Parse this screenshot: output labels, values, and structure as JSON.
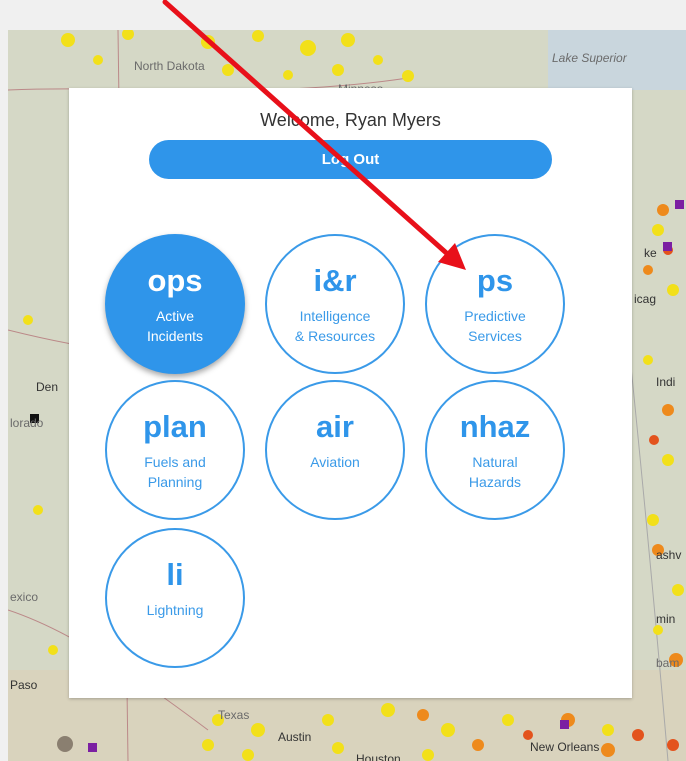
{
  "map": {
    "labels": {
      "north_dakota": "North Dakota",
      "minnesota": "Minneso",
      "lake_superior": "Lake Superior",
      "chicago": "icag",
      "milwaukee": "ke",
      "indiana": "Indi",
      "denver": "Den",
      "colorado": "lorado",
      "mexico": "exico",
      "el_paso": "Paso",
      "texas": "Texas",
      "austin": "Austin",
      "houston": "Houston",
      "new_orleans": "New Orleans",
      "nashville": "ashv",
      "birmingham": "min",
      "alabama": "bam"
    },
    "colors": {
      "fire_yellow": "#f2e01a",
      "fire_orange": "#ee8a1c",
      "fire_red": "#e3531d",
      "marker_purple": "#7b1fa2"
    }
  },
  "panel": {
    "welcome": "Welcome, Ryan Myers",
    "logout_label": "Log Out"
  },
  "tiles": [
    {
      "code": "ops",
      "label1": "Active",
      "label2": "Incidents",
      "active": true
    },
    {
      "code": "i&r",
      "label1": "Intelligence",
      "label2": "& Resources",
      "active": false
    },
    {
      "code": "ps",
      "label1": "Predictive",
      "label2": "Services",
      "active": false
    },
    {
      "code": "plan",
      "label1": "Fuels and",
      "label2": "Planning",
      "active": false
    },
    {
      "code": "air",
      "label1": "Aviation",
      "label2": "",
      "active": false
    },
    {
      "code": "nhaz",
      "label1": "Natural",
      "label2": "Hazards",
      "active": false
    },
    {
      "code": "li",
      "label1": "Lightning",
      "label2": "",
      "active": false
    }
  ],
  "annotation": {
    "arrow_color": "#e8101a",
    "icon": "red-arrow-icon"
  }
}
